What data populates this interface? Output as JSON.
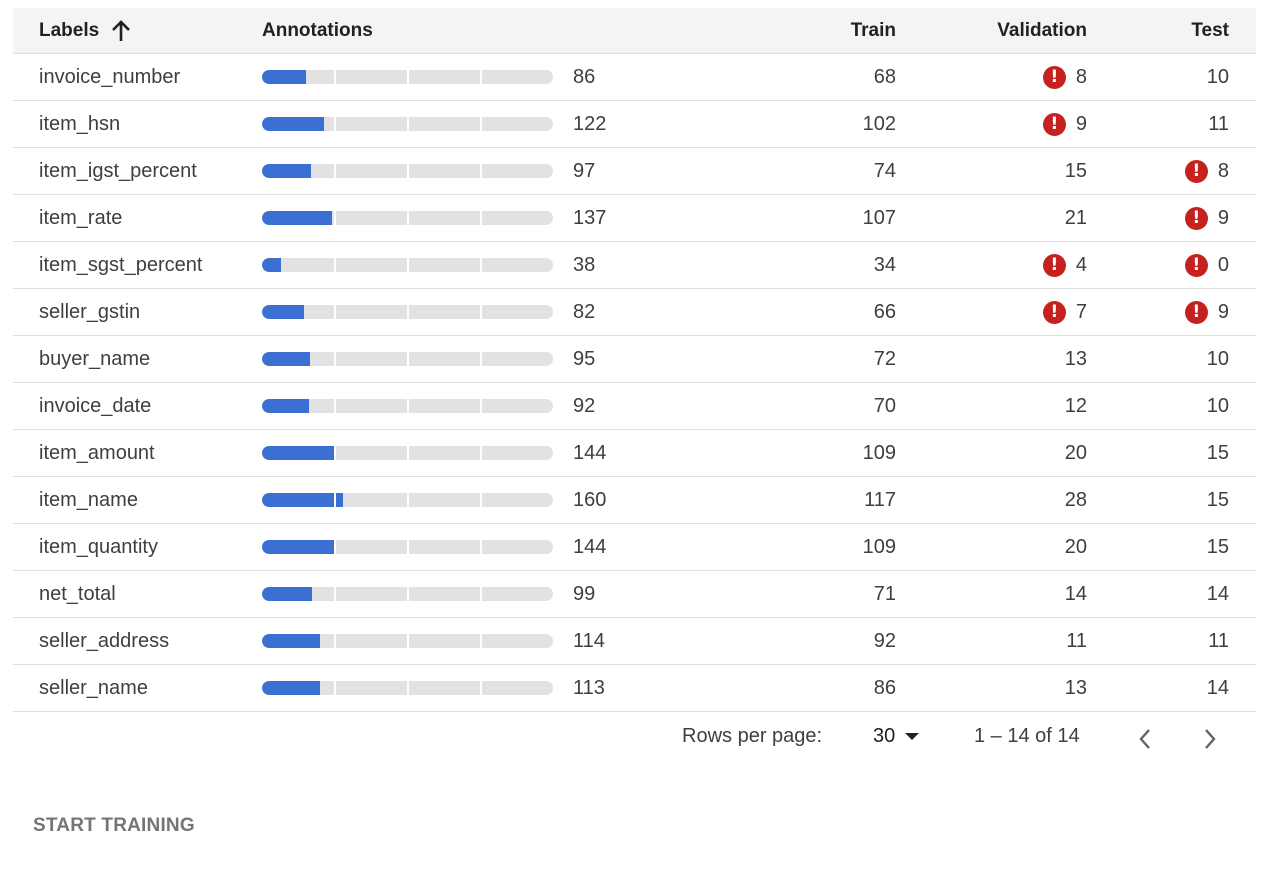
{
  "table": {
    "headers": {
      "labels": "Labels",
      "annotations": "Annotations",
      "train": "Train",
      "validation": "Validation",
      "test": "Test"
    },
    "sort": {
      "column": "Labels",
      "direction": "ascending",
      "icon": "arrow-up-icon"
    },
    "bar_color": "#3b6fd4",
    "warning_color": "#c5221f",
    "rows": [
      {
        "label": "invoice_number",
        "annotations": "86",
        "fill": 0.086,
        "train": "68",
        "validation": "8",
        "validation_warning": true,
        "test": "10",
        "test_warning": false
      },
      {
        "label": "item_hsn",
        "annotations": "122",
        "fill": 0.122,
        "train": "102",
        "validation": "9",
        "validation_warning": true,
        "test": "11",
        "test_warning": false
      },
      {
        "label": "item_igst_percent",
        "annotations": "97",
        "fill": 0.097,
        "train": "74",
        "validation": "15",
        "validation_warning": false,
        "test": "8",
        "test_warning": true
      },
      {
        "label": "item_rate",
        "annotations": "137",
        "fill": 0.137,
        "train": "107",
        "validation": "21",
        "validation_warning": false,
        "test": "9",
        "test_warning": true
      },
      {
        "label": "item_sgst_percent",
        "annotations": "38",
        "fill": 0.038,
        "train": "34",
        "validation": "4",
        "validation_warning": true,
        "test": "0",
        "test_warning": true
      },
      {
        "label": "seller_gstin",
        "annotations": "82",
        "fill": 0.082,
        "train": "66",
        "validation": "7",
        "validation_warning": true,
        "test": "9",
        "test_warning": true
      },
      {
        "label": "buyer_name",
        "annotations": "95",
        "fill": 0.095,
        "train": "72",
        "validation": "13",
        "validation_warning": false,
        "test": "10",
        "test_warning": false
      },
      {
        "label": "invoice_date",
        "annotations": "92",
        "fill": 0.092,
        "train": "70",
        "validation": "12",
        "validation_warning": false,
        "test": "10",
        "test_warning": false
      },
      {
        "label": "item_amount",
        "annotations": "144",
        "fill": 0.144,
        "train": "109",
        "validation": "20",
        "validation_warning": false,
        "test": "15",
        "test_warning": false
      },
      {
        "label": "item_name",
        "annotations": "160",
        "fill": 0.16,
        "train": "117",
        "validation": "28",
        "validation_warning": false,
        "test": "15",
        "test_warning": false
      },
      {
        "label": "item_quantity",
        "annotations": "144",
        "fill": 0.144,
        "train": "109",
        "validation": "20",
        "validation_warning": false,
        "test": "15",
        "test_warning": false
      },
      {
        "label": "net_total",
        "annotations": "99",
        "fill": 0.099,
        "train": "71",
        "validation": "14",
        "validation_warning": false,
        "test": "14",
        "test_warning": false
      },
      {
        "label": "seller_address",
        "annotations": "114",
        "fill": 0.114,
        "train": "92",
        "validation": "11",
        "validation_warning": false,
        "test": "11",
        "test_warning": false
      },
      {
        "label": "seller_name",
        "annotations": "113",
        "fill": 0.113,
        "train": "86",
        "validation": "13",
        "validation_warning": false,
        "test": "14",
        "test_warning": false
      }
    ]
  },
  "pagination": {
    "rows_per_page_label": "Rows per page:",
    "rows_per_page_value": "30",
    "range_text": "1 – 14 of 14",
    "prev_icon": "chevron-left-icon",
    "next_icon": "chevron-right-icon"
  },
  "actions": {
    "start_training_label": "START TRAINING"
  }
}
